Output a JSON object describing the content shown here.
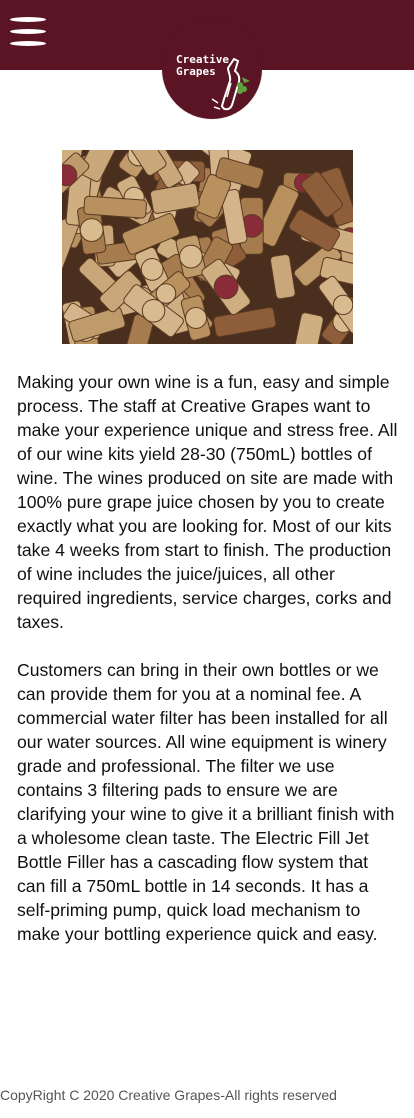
{
  "header": {
    "menu_icon": "hamburger-menu-icon",
    "background_color": "#5b1424",
    "logo": {
      "line1": "Creative",
      "line2": "Grapes",
      "icon": "wine-bottle-grapes-icon"
    }
  },
  "hero_image": {
    "subject": "pile of wine corks"
  },
  "content": {
    "paragraph1": "Making your own wine is a fun, easy and simple process. The staff at Creative Grapes want to make your experience unique and stress free.  All of our wine kits yield 28-30 (750mL) bottles of wine. The wines produced on site are made with 100% pure grape juice chosen by you to create exactly what you are looking for. Most of our kits take 4 weeks from start to finish.  The production of wine includes the juice/juices, all other required ingredients, service charges, corks and taxes.",
    "paragraph2": "Customers can bring in their own bottles or we can provide them for you at a nominal fee. A commercial water filter has been installed for all our water sources. All wine equipment is winery grade and professional.   The filter we use contains 3 filtering pads to ensure we are clarifying your wine to give it a brilliant finish with a wholesome clean taste. The Electric Fill Jet Bottle Filler has a cascading flow system that can fill a 750mL bottle in 14 seconds.  It has a self-priming pump, quick load mechanism to make your bottling  experience quick and easy."
  },
  "footer": {
    "text": "CopyRight C 2020 Creative Grapes-All rights reserved"
  }
}
